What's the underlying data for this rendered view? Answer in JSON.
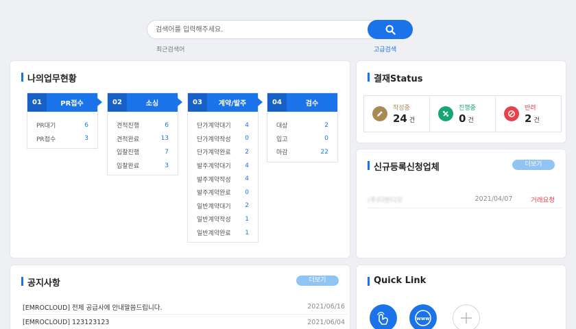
{
  "search": {
    "placeholder": "검색어를 입력해주세요.",
    "recent_label": "최근검색어",
    "advanced_label": "고급검색"
  },
  "my_work": {
    "title": "나의업무현황",
    "stages": [
      {
        "num": "01",
        "title": "PR접수",
        "rows": [
          {
            "label": "PR대기",
            "value": "6"
          },
          {
            "label": "PR접수",
            "value": "3"
          }
        ]
      },
      {
        "num": "02",
        "title": "소싱",
        "rows": [
          {
            "label": "견적진행",
            "value": "6"
          },
          {
            "label": "견적완료",
            "value": "13"
          },
          {
            "label": "입찰진행",
            "value": "7"
          },
          {
            "label": "입찰완료",
            "value": "3"
          }
        ]
      },
      {
        "num": "03",
        "title": "계약/발주",
        "rows": [
          {
            "label": "단가계약대기",
            "value": "4"
          },
          {
            "label": "단가계약작성",
            "value": "0"
          },
          {
            "label": "단가계약완료",
            "value": "2"
          },
          {
            "label": "발주계약대기",
            "value": "4"
          },
          {
            "label": "발주계약작성",
            "value": "4"
          },
          {
            "label": "발주계약완료",
            "value": "0"
          },
          {
            "label": "일반계약대기",
            "value": "2"
          },
          {
            "label": "일반계약작성",
            "value": "1"
          },
          {
            "label": "일반계약완료",
            "value": "1"
          }
        ]
      },
      {
        "num": "04",
        "title": "검수",
        "rows": [
          {
            "label": "대상",
            "value": "2"
          },
          {
            "label": "입고",
            "value": "0"
          },
          {
            "label": "마감",
            "value": "22"
          }
        ]
      }
    ]
  },
  "approval": {
    "title": "결재Status",
    "unit": "건",
    "items": [
      {
        "label": "작성중",
        "count": "24",
        "color": "#a88a52",
        "icon": "pencil-icon"
      },
      {
        "label": "진행중",
        "count": "0",
        "color": "#17a673",
        "icon": "arrows-icon"
      },
      {
        "label": "반려",
        "count": "2",
        "color": "#e8414e",
        "icon": "prohibited-icon"
      }
    ]
  },
  "vendor": {
    "title": "신규등록신청업체",
    "more": "더보기",
    "rows": [
      {
        "name": "(주)다빈디오",
        "date": "2021/04/07",
        "status": "거래요청",
        "status_color": "#e8414e"
      }
    ]
  },
  "notice": {
    "title": "공지사항",
    "more": "더보기",
    "rows": [
      {
        "title": "[EMROCLOUD] 전체 공급사에 안내말씀드립니다.",
        "date": "2021/06/16"
      },
      {
        "title": "[EMROCLOUD] 123123123",
        "date": "2021/06/04"
      }
    ]
  },
  "quick_link": {
    "title": "Quick Link",
    "items": [
      {
        "icon": "hand-touch-icon",
        "color": "#1a73e8"
      },
      {
        "icon": "www-globe-icon",
        "color": "#1a73e8"
      },
      {
        "icon": "plus-icon",
        "color": "#ffffff"
      }
    ]
  }
}
